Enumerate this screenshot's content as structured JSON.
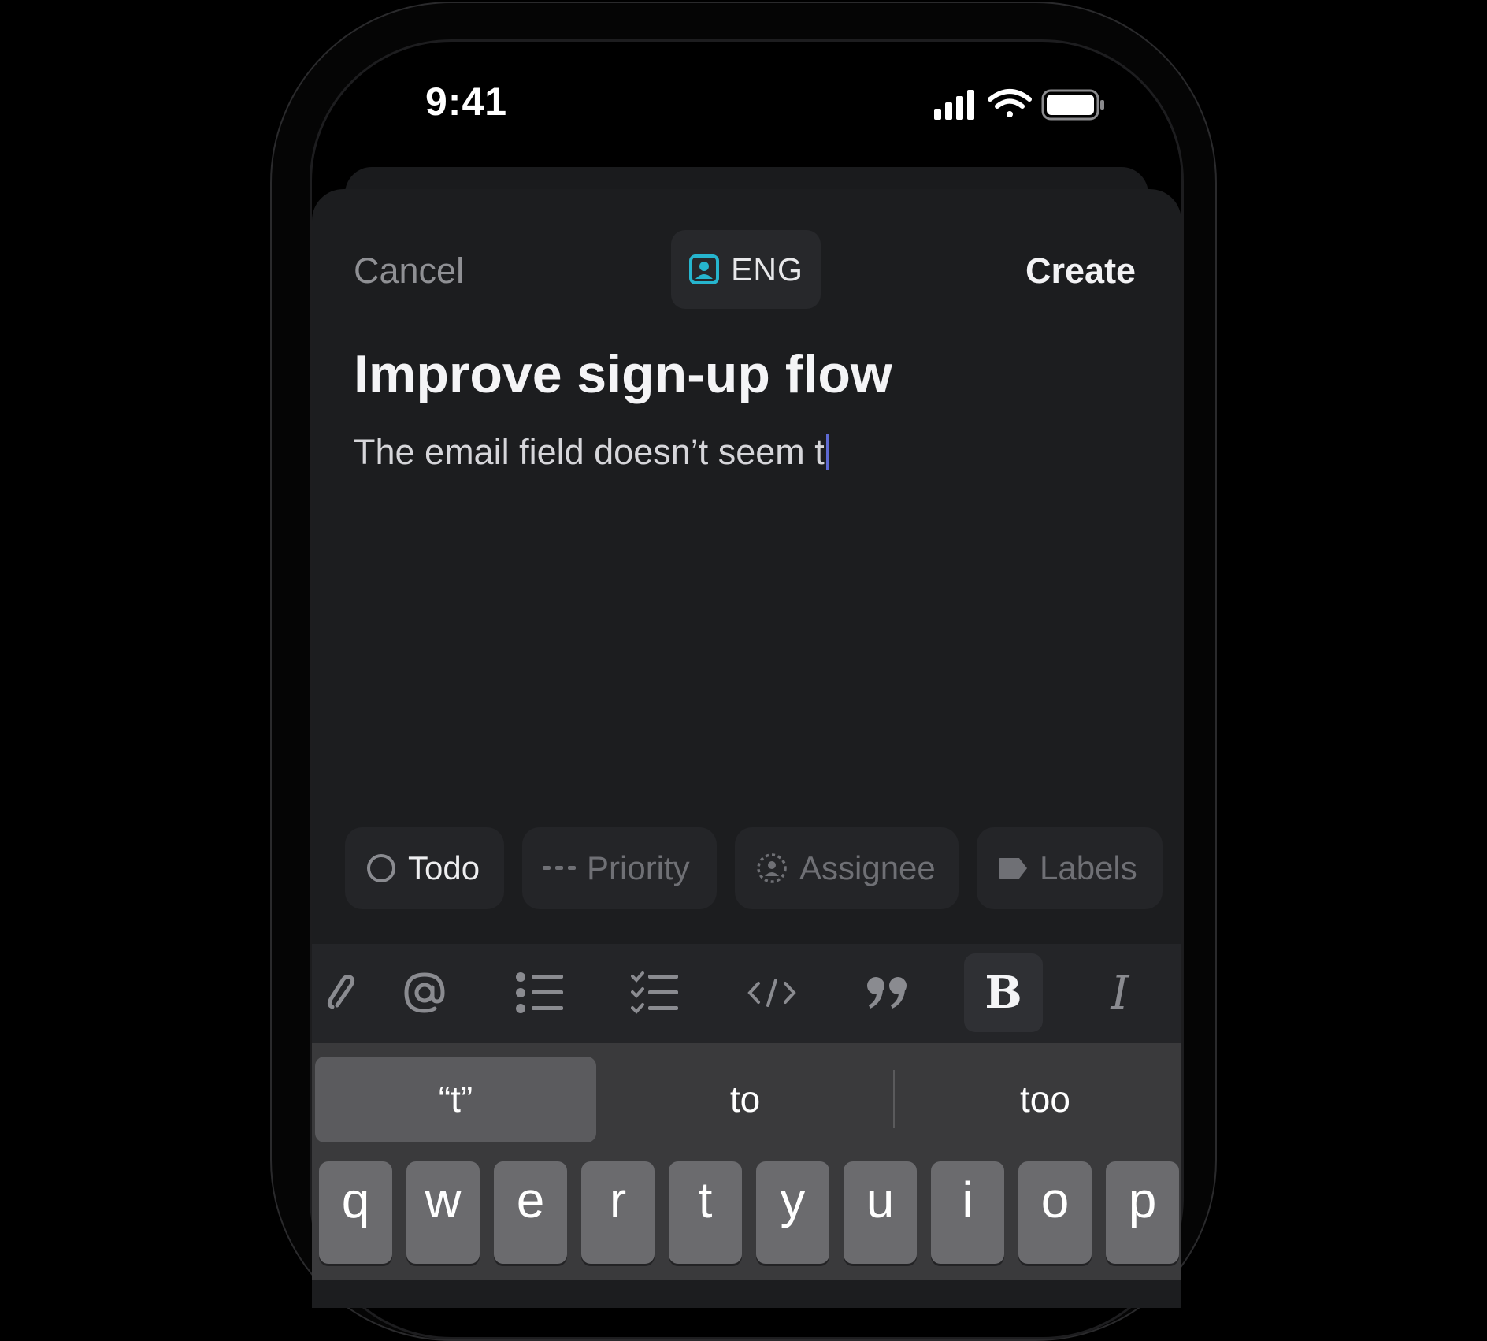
{
  "status_bar": {
    "time": "9:41"
  },
  "header": {
    "cancel_label": "Cancel",
    "team_label": "ENG",
    "create_label": "Create"
  },
  "issue": {
    "title": "Improve sign-up flow",
    "description": "The email field doesn’t seem t"
  },
  "properties": {
    "status_label": "Todo",
    "priority_label": "Priority",
    "assignee_label": "Assignee",
    "labels_label": "Labels"
  },
  "toolbar": {
    "items": [
      "attachment-icon",
      "mention-icon",
      "bullet-list-icon",
      "checklist-icon",
      "code-icon",
      "quote-icon",
      "bold-icon",
      "italic-icon"
    ],
    "active_item": "bold-icon"
  },
  "keyboard": {
    "suggestions": [
      "“t”",
      "to",
      "too"
    ],
    "row1": [
      "q",
      "w",
      "e",
      "r",
      "t",
      "y",
      "u",
      "i",
      "o",
      "p"
    ]
  },
  "colors": {
    "accent": "#5e6ad2",
    "team_icon": "#26b5ce",
    "background": "#1c1d1f"
  }
}
